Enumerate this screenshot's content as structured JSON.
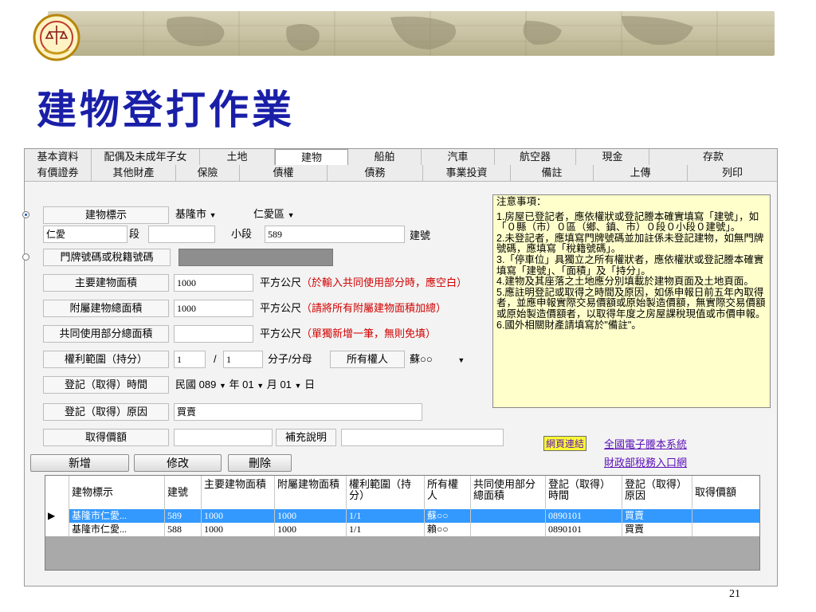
{
  "slide": {
    "title": "建物登打作業",
    "page_number": "21"
  },
  "tabs_row1": [
    "基本資料",
    "配偶及未成年子女",
    "土地",
    "建物",
    "船舶",
    "汽車",
    "航空器",
    "現金",
    "存款"
  ],
  "tabs_row2": [
    "有價證券",
    "其他財產",
    "保險",
    "債權",
    "債務",
    "事業投資",
    "備註",
    "上傳",
    "列印"
  ],
  "form": {
    "building_label": "建物標示",
    "city": "基隆市",
    "district": "仁愛區",
    "section_value": "仁愛",
    "section_label": "段",
    "subsection_label": "小段",
    "building_no_value": "589",
    "building_no_label": "建號",
    "door_label": "門牌號碼或稅籍號碼",
    "main_area_label": "主要建物面積",
    "main_area_value": "1000",
    "main_area_unit": "平方公尺",
    "main_area_note": "（於輸入共同使用部分時，應空白）",
    "aux_area_label": "附屬建物總面積",
    "aux_area_value": "1000",
    "aux_area_unit": "平方公尺",
    "aux_area_note": "（請將所有附屬建物面積加總）",
    "common_area_label": "共同使用部分總面積",
    "common_area_value": "",
    "common_area_unit": "平方公尺",
    "common_area_note": "（單獨新增一筆，無則免填）",
    "share_label": "權利範圍（持分）",
    "share_num": "1",
    "share_slash": "/",
    "share_den": "1",
    "share_unit": "分子/分母",
    "owner_label": "所有權人",
    "owner_value": "蘇○○",
    "reg_time_label": "登記（取得）時間",
    "era": "民國",
    "year": "089",
    "year_label": "年",
    "month": "01",
    "month_label": "月",
    "day": "01",
    "day_label": "日",
    "reg_reason_label": "登記（取得）原因",
    "reg_reason_value": "買賣",
    "price_label": "取得價額",
    "price_value": "",
    "supp_label": "補充說明",
    "supp_value": ""
  },
  "buttons": {
    "add": "新增",
    "edit": "修改",
    "delete": "刪除"
  },
  "notice": {
    "title": "注意事項：",
    "items": [
      "1.房屋已登記者，應依權狀或登記謄本確實填寫「建號」，如「０縣（市）０區（鄉、鎮、市）０段０小段０建號」。",
      "2.未登記者，應填寫門牌號碼並加註係未登記建物，如無門牌號碼，應填寫「稅籍號碼」。",
      "3.「停車位」具獨立之所有權狀者，應依權狀或登記謄本確實填寫「建號」、「面積」及「持分」。",
      "4.建物及其座落之土地應分別填載於建物頁面及土地頁面。",
      "5.應註明登記或取得之時間及原因，如係申報日前五年內取得者，並應申報實際交易價額或原始製造價額，無實際交易價額或原始製造價額者，以取得年度之房屋課稅現值或市價申報。",
      "6.國外相關財產請填寫於\"備註\"。"
    ]
  },
  "links": {
    "web_link_label": "網頁連結",
    "link1": "全國電子謄本系統",
    "link2": "財政部稅務入口網"
  },
  "table": {
    "headers": [
      "建物標示",
      "建號",
      "主要建物面積",
      "附屬建物面積",
      "權利範圍（持分）",
      "所有權人",
      "共同使用部分總面積",
      "登記（取得）時間",
      "登記（取得）原因",
      "取得價額"
    ],
    "rows": [
      [
        "基隆市仁愛...",
        "589",
        "1000",
        "1000",
        "1/1",
        "蘇○○",
        "",
        "0890101",
        "買賣",
        ""
      ],
      [
        "基隆市仁愛...",
        "588",
        "1000",
        "1000",
        "1/1",
        "賴○○",
        "",
        "0890101",
        "買賣",
        ""
      ]
    ]
  },
  "colors": {
    "title": "#1a1fa8",
    "selected_row": "#3399ff",
    "notice_bg": "#ffffcc",
    "note_red": "#d10000",
    "link": "#5b0fb8"
  }
}
